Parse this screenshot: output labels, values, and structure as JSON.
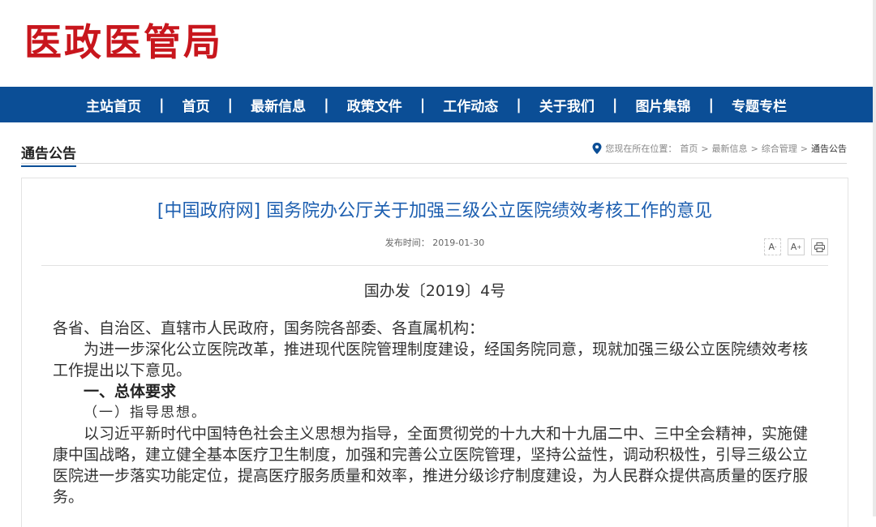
{
  "site": {
    "logo": "医政医管局"
  },
  "nav": {
    "items": [
      "主站首页",
      "首页",
      "最新信息",
      "政策文件",
      "工作动态",
      "关于我们",
      "图片集锦",
      "专题专栏"
    ],
    "separator": "|"
  },
  "section": {
    "title": "通告公告"
  },
  "breadcrumb": {
    "prefix": "您现在所在位置：",
    "items": [
      "首页",
      "最新信息",
      "综合管理"
    ],
    "current": "通告公告",
    "separator": ">"
  },
  "article": {
    "title": "[中国政府网] 国务院办公厅关于加强三级公立医院绩效考核工作的意见",
    "publish_label": "发布时间：",
    "publish_date": "2019-01-30",
    "tools": {
      "font_decrease": "A-",
      "font_increase": "A+",
      "print": "print"
    },
    "doc_number": "国办发〔2019〕4号",
    "salutation": "各省、自治区、直辖市人民政府，国务院各部委、各直属机构：",
    "para1": "为进一步深化公立医院改革，推进现代医院管理制度建设，经国务院同意，现就加强三级公立医院绩效考核工作提出以下意见。",
    "heading1": "一、总体要求",
    "sub1": "（一）指导思想。",
    "para2": "以习近平新时代中国特色社会主义思想为指导，全面贯彻党的十九大和十九届二中、三中全会精神，实施健康中国战略，建立健全基本医疗卫生制度，加强和完善公立医院管理，坚持公益性，调动积极性，引导三级公立医院进一步落实功能定位，提高医疗服务质量和效率，推进分级诊疗制度建设，为人民群众提供高质量的医疗服务。"
  },
  "colors": {
    "brand_red": "#c8161d",
    "nav_blue": "#0b4e96",
    "title_blue": "#1d5fb0"
  },
  "icons": {
    "location": "location-pin-icon",
    "print": "printer-icon"
  }
}
